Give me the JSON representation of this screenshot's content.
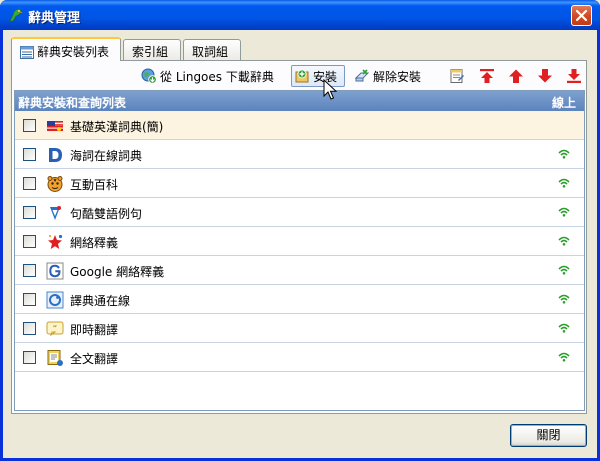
{
  "window": {
    "title": "辭典管理"
  },
  "tabs": [
    {
      "label": "辭典安裝列表",
      "active": true
    },
    {
      "label": "索引組",
      "active": false
    },
    {
      "label": "取詞組",
      "active": false
    }
  ],
  "toolbar": {
    "download_label": "從 Lingoes 下載辭典",
    "install_label": "安裝",
    "uninstall_label": "解除安裝"
  },
  "list": {
    "header_name": "辭典安裝和查詢列表",
    "header_online": "線上",
    "items": [
      {
        "name": "基礎英漢詞典(簡)",
        "icon": "flag-icon",
        "online": false,
        "selected": true,
        "checked": false
      },
      {
        "name": "海詞在線詞典",
        "icon": "dict-d-icon",
        "online": true,
        "selected": false,
        "checked": false
      },
      {
        "name": "互動百科",
        "icon": "tiger-icon",
        "online": true,
        "selected": false,
        "checked": false
      },
      {
        "name": "句酷雙語例句",
        "icon": "ju-icon",
        "online": true,
        "selected": false,
        "checked": false
      },
      {
        "name": "網絡釋義",
        "icon": "star-icon",
        "online": true,
        "selected": false,
        "checked": false
      },
      {
        "name": "Google 網絡釋義",
        "icon": "google-icon",
        "online": true,
        "selected": false,
        "checked": false
      },
      {
        "name": "譯典通在線",
        "icon": "ring-icon",
        "online": true,
        "selected": false,
        "checked": false
      },
      {
        "name": "即時翻譯",
        "icon": "quote-icon",
        "online": true,
        "selected": false,
        "checked": false
      },
      {
        "name": "全文翻譯",
        "icon": "doc-translate-icon",
        "online": true,
        "selected": false,
        "checked": false
      }
    ]
  },
  "footer": {
    "close_label": "關閉"
  },
  "colors": {
    "title_bar": "#0055e5",
    "list_header": "#6a8fc6",
    "selected_row": "#fcf4e0",
    "arrow_red": "#e02020",
    "online_green": "#2aa02a"
  }
}
